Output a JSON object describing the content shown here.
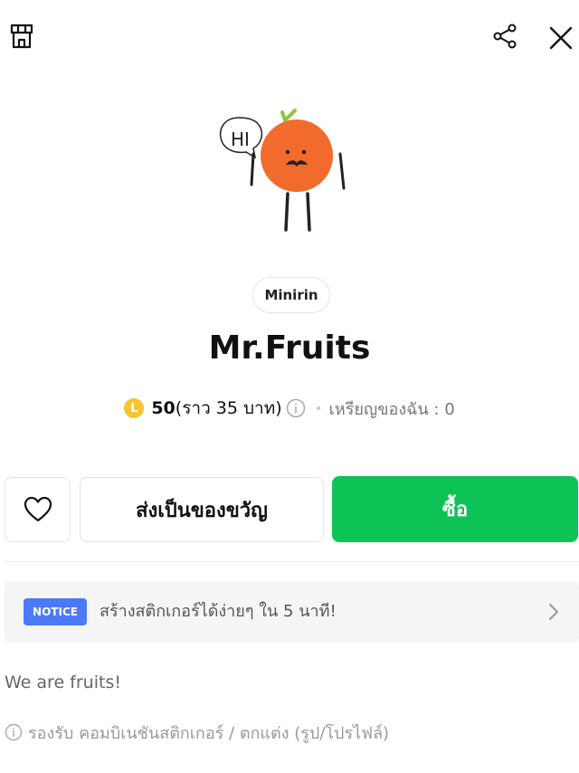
{
  "product": {
    "author": "Minirin",
    "title": "Mr.Fruits",
    "sticker_text": "HI"
  },
  "price": {
    "coin_letter": "L",
    "coins": "50",
    "approx": "(ราว 35 บาท)",
    "balance": "เหรียญของฉัน : 0"
  },
  "actions": {
    "gift_label": "ส่งเป็นของขวัญ",
    "buy_label": "ซื้อ"
  },
  "notice": {
    "badge": "NOTICE",
    "text": "สร้างสติกเกอร์ได้ง่ายๆ ใน 5 นาที!"
  },
  "description": "We are fruits!",
  "support": "รองรับ คอมบิเนชันสติกเกอร์ / ตกแต่ง (รูป/โปรไฟล์)",
  "icons": {
    "shop": "shop-icon",
    "share": "share-icon",
    "close": "close-icon",
    "heart": "heart-icon",
    "info": "info-icon",
    "chevron": "chevron-right-icon"
  },
  "colors": {
    "buy": "#0ec356",
    "notice_badge": "#4c79f5",
    "coin": "#f6c533",
    "orange": "#f26b2c",
    "leaf": "#8cc63f"
  }
}
